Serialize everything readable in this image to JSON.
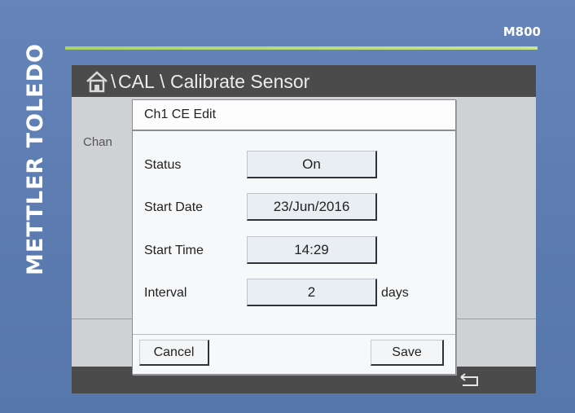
{
  "device": {
    "brand": "METTLER TOLEDO",
    "model": "M800"
  },
  "colors": {
    "bezel": "#5f7fb4",
    "accent": "#a8d36a",
    "titlebar": "#4b4b4b",
    "screen": "#cfd1d4"
  },
  "breadcrumb": {
    "home_icon": "home-icon",
    "separator": "\\",
    "items": [
      "CAL",
      "Calibrate Sensor"
    ]
  },
  "background": {
    "partial_label": "Chan"
  },
  "dialog": {
    "title": "Ch1 CE Edit",
    "rows": [
      {
        "label": "Status",
        "value": "On",
        "unit": ""
      },
      {
        "label": "Start Date",
        "value": "23/Jun/2016",
        "unit": ""
      },
      {
        "label": "Start Time",
        "value": "14:29",
        "unit": ""
      },
      {
        "label": "Interval",
        "value": "2",
        "unit": "days"
      }
    ],
    "cancel_label": "Cancel",
    "save_label": "Save"
  },
  "bottombar": {
    "back_icon": "back-arrow-icon"
  }
}
